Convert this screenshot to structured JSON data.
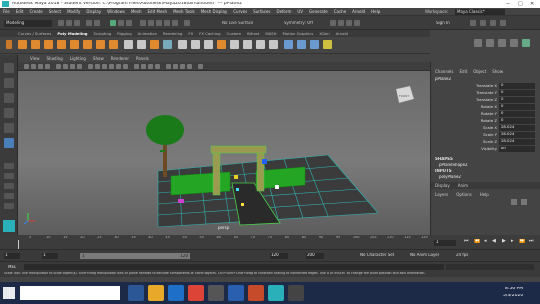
{
  "window": {
    "title": "Autodesk Maya 2018 - Student Version: C:\\Program Files\\Autodesk\\Maya2018\\bin\\untitled*  ---  pPlane2",
    "controls": [
      "−",
      "□",
      "✕"
    ]
  },
  "menubar": [
    "File",
    "Edit",
    "Create",
    "Select",
    "Modify",
    "Display",
    "Windows",
    "Mesh",
    "Edit Mesh",
    "Mesh Tools",
    "Mesh Display",
    "Curves",
    "Surfaces",
    "Deform",
    "UV",
    "Generate",
    "Cache",
    "Arnold",
    "Help"
  ],
  "workspace": {
    "label": "Workspace:",
    "value": "Maya Classic*"
  },
  "statusline": {
    "mode": "Modeling",
    "live_surface": "No Live Surface",
    "symmetry": "Symmetry: Off",
    "sign_in": "Sign In"
  },
  "shelf_tabs": [
    "Curves / Surfaces",
    "Poly Modeling",
    "Sculpting",
    "Rigging",
    "Animation",
    "Rendering",
    "FX",
    "FX Caching",
    "Custom",
    "Bifrost",
    "MASH",
    "Motion Graphics",
    "XGen",
    "Arnold"
  ],
  "active_shelf_tab": "Poly Modeling",
  "viewport": {
    "menu": [
      "View",
      "Shading",
      "Lighting",
      "Show",
      "Renderer",
      "Panels"
    ],
    "camera_label": "persp",
    "view_cube_label": "FRONT",
    "grid_color": "#2fb3b0",
    "ground_color": "#3a3a3a"
  },
  "channelbox": {
    "tabs": [
      "Channels",
      "Edit",
      "Object",
      "Show"
    ],
    "object": "pPlane2",
    "attributes": [
      {
        "label": "Translate X",
        "value": "0"
      },
      {
        "label": "Translate Y",
        "value": "0"
      },
      {
        "label": "Translate Z",
        "value": "0"
      },
      {
        "label": "Rotate X",
        "value": "0"
      },
      {
        "label": "Rotate Y",
        "value": "0"
      },
      {
        "label": "Rotate Z",
        "value": "0"
      },
      {
        "label": "Scale X",
        "value": "28.024"
      },
      {
        "label": "Scale Y",
        "value": "28.024"
      },
      {
        "label": "Scale Z",
        "value": "28.024"
      },
      {
        "label": "Visibility",
        "value": "on"
      }
    ],
    "shapes_header": "SHAPES",
    "shape": "pPlaneShape2",
    "inputs_header": "INPUTS",
    "input": "polyPlane2",
    "display_tabs": [
      "Display",
      "Anim"
    ],
    "layer_tabs": [
      "Layers",
      "Options",
      "Help"
    ]
  },
  "timeline": {
    "ticks": [
      "5",
      "10",
      "15",
      "20",
      "25",
      "30",
      "35",
      "40",
      "45",
      "50",
      "55",
      "60",
      "65",
      "70",
      "75",
      "80",
      "85",
      "90",
      "95",
      "100",
      "105",
      "110",
      "115",
      "120"
    ],
    "current_frame": "1"
  },
  "range": {
    "start": "1",
    "playback_start": "1",
    "playback_end": "120",
    "end_a": "120",
    "end_b": "200",
    "character_set": "No Character Set",
    "anim_layer": "No Anim Layer",
    "fps": "24 fps"
  },
  "mel": {
    "label": "MEL"
  },
  "helpline": "Scale Tool: Use manipulator to scale object(s). Shift+drag manipulator axis or plane handles to extrude components or clone objects. Ctrl+Shift+LMB+drag to constrain scaling to connected edges. Use D or INSERT to change the pivot position and axis orientation.",
  "taskbar": {
    "time": "8:56 PM",
    "date": "5/3/2020"
  }
}
